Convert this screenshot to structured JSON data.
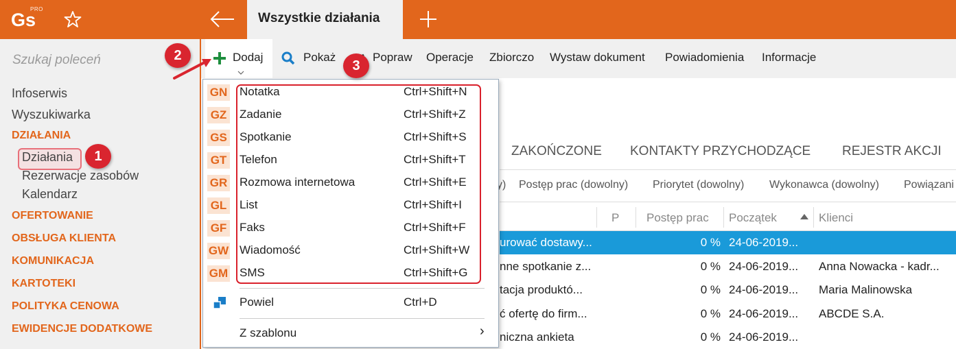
{
  "app": {
    "logo": "Gs",
    "logo_sup": "PRO",
    "active_tab": "Wszystkie działania"
  },
  "sidebar": {
    "search_placeholder": "Szukaj poleceń",
    "top_items": [
      "Infoserwis",
      "Wyszukiwarka"
    ],
    "section_dzialania": "DZIAŁANIA",
    "sub_items": [
      "Działania",
      "Rezerwacje zasobów",
      "Kalendarz"
    ],
    "sections": [
      "OFERTOWANIE",
      "OBSŁUGA KLIENTA",
      "KOMUNIKACJA",
      "KARTOTEKI",
      "POLITYKA CENOWA",
      "EWIDENCJE DODATKOWE"
    ]
  },
  "toolbar": {
    "dodaj": "Dodaj",
    "pokaz": "Pokaż",
    "popraw": "Popraw",
    "operacje": "Operacje",
    "zbiorczo": "Zbiorczo",
    "wystaw": "Wystaw dokument",
    "powiadomienia": "Powiadomienia",
    "informacje": "Informacje"
  },
  "content_tabs": [
    "ZAKOŃCZONE",
    "KONTAKTY PRZYCHODZĄCE",
    "REJESTR AKCJI"
  ],
  "filters": [
    "y)",
    "Postęp prac (dowolny)",
    "Priorytet (dowolny)",
    "Wykonawca (dowolny)",
    "Powiązani"
  ],
  "grid": {
    "headers": {
      "p": "P",
      "postep": "Postęp prac",
      "poczatek": "Początek",
      "klienci": "Klienci"
    },
    "rows": [
      {
        "name": "urować dostawy...",
        "postep": "0 %",
        "poczatek": "24-06-2019...",
        "klienci": ""
      },
      {
        "name": "nne spotkanie z...",
        "postep": "0 %",
        "poczatek": "24-06-2019...",
        "klienci": "Anna Nowacka - kadr..."
      },
      {
        "name": "tacja produktó...",
        "postep": "0 %",
        "poczatek": "24-06-2019...",
        "klienci": "Maria Malinowska"
      },
      {
        "name": "ć ofertę do firm...",
        "postep": "0 %",
        "poczatek": "24-06-2019...",
        "klienci": "ABCDE S.A."
      },
      {
        "name": "niczna ankieta",
        "postep": "0 %",
        "poczatek": "24-06-2019...",
        "klienci": ""
      }
    ]
  },
  "menu": {
    "items": [
      {
        "code": "GN",
        "label": "Notatka",
        "shortcut": "Ctrl+Shift+N"
      },
      {
        "code": "GZ",
        "label": "Zadanie",
        "shortcut": "Ctrl+Shift+Z"
      },
      {
        "code": "GS",
        "label": "Spotkanie",
        "shortcut": "Ctrl+Shift+S"
      },
      {
        "code": "GT",
        "label": "Telefon",
        "shortcut": "Ctrl+Shift+T"
      },
      {
        "code": "GR",
        "label": "Rozmowa internetowa",
        "shortcut": "Ctrl+Shift+E"
      },
      {
        "code": "GL",
        "label": "List",
        "shortcut": "Ctrl+Shift+I"
      },
      {
        "code": "GF",
        "label": "Faks",
        "shortcut": "Ctrl+Shift+F"
      },
      {
        "code": "GW",
        "label": "Wiadomość",
        "shortcut": "Ctrl+Shift+W"
      },
      {
        "code": "GM",
        "label": "SMS",
        "shortcut": "Ctrl+Shift+G"
      }
    ],
    "powiel": {
      "label": "Powiel",
      "shortcut": "Ctrl+D"
    },
    "szablon": {
      "label": "Z szablonu",
      "arrow": "›"
    }
  },
  "annotations": {
    "one": "1",
    "two": "2",
    "three": "3"
  },
  "colors": {
    "brand": "#e2661c",
    "selection": "#1a9ad9",
    "annotation": "#d9252f"
  }
}
